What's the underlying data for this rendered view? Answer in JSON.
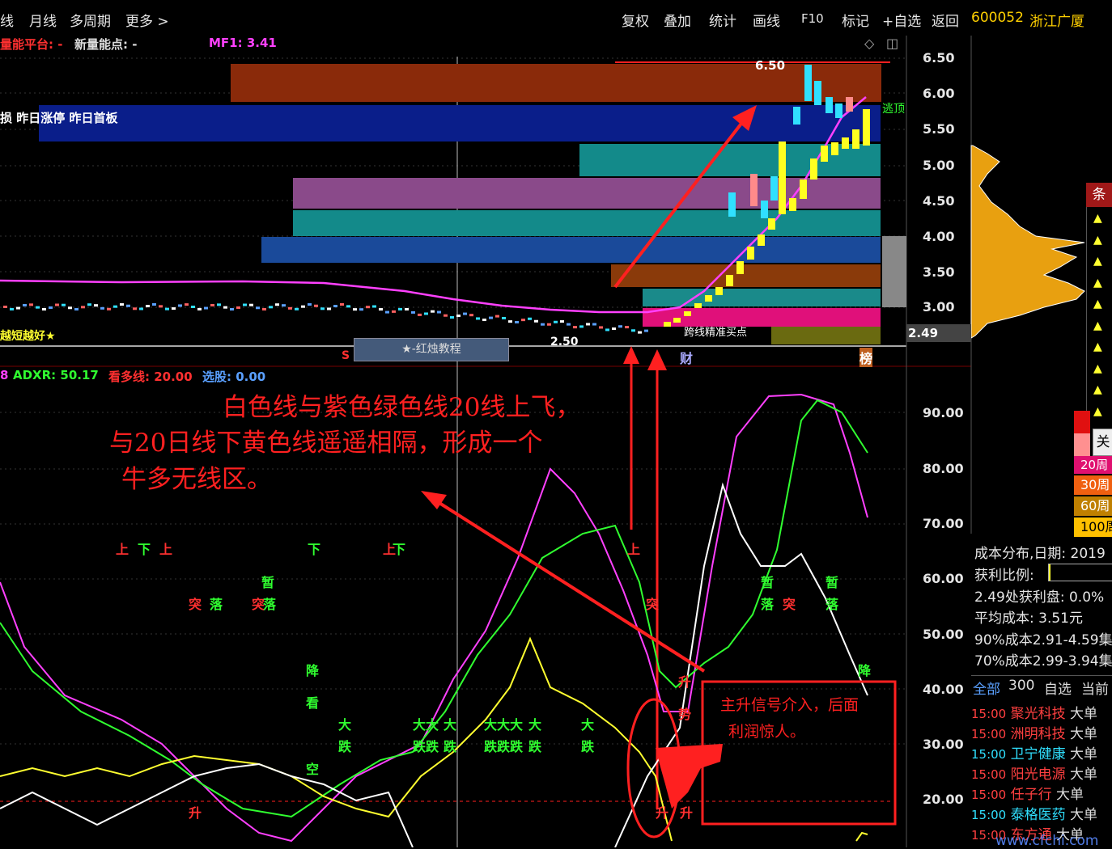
{
  "topbar": {
    "left_items": [
      "线",
      "月线",
      "多周期",
      "更多 >"
    ],
    "right_items": [
      "复权",
      "叠加",
      "统计",
      "画线",
      "F10",
      "标记",
      "+自选",
      "返回"
    ],
    "stock_code": "600052",
    "stock_name": "浙江广厦"
  },
  "indicator_top": {
    "left_label": "量能平台: -",
    "new_label": "新量能点: -",
    "mf1_label": "MF1: 3.41"
  },
  "price_chart": {
    "price_axis": [
      "6.50",
      "6.00",
      "5.50",
      "5.00",
      "4.50",
      "4.00",
      "3.50",
      "3.00"
    ],
    "current_price": "2.49",
    "high_label": "6.50",
    "low_label": "2.50",
    "band_label_left": "损 昨日涨停 昨日首板",
    "bottom_label": "越短越好★",
    "strategy_box": "★-红烛教程",
    "tag_s": "S",
    "tag_cai": "财",
    "tag_bang": "榜",
    "escape_label": "逃顶",
    "signal_label": "跨线精准买点"
  },
  "osc_chart": {
    "header_value": "8",
    "adxr_label": "ADXR: 50.17",
    "bull_label": "看多线: 20.00",
    "select_label": "选股: 0.00",
    "axis": [
      "90.00",
      "80.00",
      "70.00",
      "60.00",
      "50.00",
      "40.00",
      "30.00",
      "20.00"
    ]
  },
  "signals": [
    {
      "t": "上",
      "c": "#ff3030"
    },
    {
      "t": "下",
      "c": "#30ff30"
    },
    {
      "t": "上",
      "c": "#ff3030"
    },
    {
      "t": "下",
      "c": "#30ff30"
    },
    {
      "t": "上",
      "c": "#ff3030"
    },
    {
      "t": "下",
      "c": "#30ff30"
    },
    {
      "t": "上",
      "c": "#ff3030"
    },
    {
      "t": "暂",
      "c": "#30ff30"
    },
    {
      "t": "突",
      "c": "#ff3030"
    },
    {
      "t": "落",
      "c": "#30ff30"
    },
    {
      "t": "突",
      "c": "#ff3030"
    },
    {
      "t": "落",
      "c": "#30ff30"
    },
    {
      "t": "暂",
      "c": "#30ff30"
    },
    {
      "t": "暂",
      "c": "#30ff30"
    },
    {
      "t": "落",
      "c": "#30ff30"
    },
    {
      "t": "突",
      "c": "#ff3030"
    },
    {
      "t": "落",
      "c": "#30ff30"
    },
    {
      "t": "突",
      "c": "#ff3030"
    },
    {
      "t": "降",
      "c": "#30ff30"
    },
    {
      "t": "看",
      "c": "#30ff30"
    },
    {
      "t": "降",
      "c": "#30ff30"
    },
    {
      "t": "大",
      "c": "#30ff30"
    },
    {
      "t": "跌",
      "c": "#30ff30"
    },
    {
      "t": "大大",
      "c": "#30ff30"
    },
    {
      "t": "跌跌",
      "c": "#30ff30"
    },
    {
      "t": "大",
      "c": "#30ff30"
    },
    {
      "t": "跌",
      "c": "#30ff30"
    },
    {
      "t": "大大大",
      "c": "#30ff30"
    },
    {
      "t": "跌跌跌",
      "c": "#30ff30"
    },
    {
      "t": "大",
      "c": "#30ff30"
    },
    {
      "t": "跌",
      "c": "#30ff30"
    },
    {
      "t": "大",
      "c": "#30ff30"
    },
    {
      "t": "跌",
      "c": "#30ff30"
    },
    {
      "t": "升",
      "c": "#ff3030"
    },
    {
      "t": "势",
      "c": "#ff3030"
    },
    {
      "t": "升",
      "c": "#ff3030"
    },
    {
      "t": "升",
      "c": "#ff3030"
    },
    {
      "t": "升",
      "c": "#ff3030"
    },
    {
      "t": "空",
      "c": "#30ff30"
    }
  ],
  "annotations": {
    "main_text_1": "白色线与紫色绿色线20线上飞，",
    "main_text_2": "与20日线下黄色线遥遥相隔，形成一个",
    "main_text_3": "牛多无线区。",
    "box_text_1": "主升信号介入，后面",
    "box_text_2": "利润惊人。"
  },
  "side_panel": {
    "tab_label": "条件",
    "close_label": "关",
    "periods": [
      "20周",
      "30周",
      "60周",
      "100周"
    ],
    "cost_title": "成本分布,日期: 2019",
    "profit_ratio_label": "获利比例:",
    "profit_at": "2.49处获利盘: 0.0%",
    "avg_cost": "平均成本: 3.51元",
    "cost90": "90%成本2.91-4.59集",
    "cost70": "70%成本2.99-3.94集",
    "list_tabs": [
      "全部",
      "300",
      "自选",
      "当前"
    ]
  },
  "stock_list": [
    {
      "time": "15:00",
      "name": "聚光科技",
      "type": "大单",
      "color": "#ff4040"
    },
    {
      "time": "15:00",
      "name": "洲明科技",
      "type": "大单",
      "color": "#ff4040"
    },
    {
      "time": "15:00",
      "name": "卫宁健康",
      "type": "大单",
      "color": "#30e0ff"
    },
    {
      "time": "15:00",
      "name": "阳光电源",
      "type": "大单",
      "color": "#ff4040"
    },
    {
      "time": "15:00",
      "name": "任子行",
      "type": "大单",
      "color": "#ff4040"
    },
    {
      "time": "15:00",
      "name": "泰格医药",
      "type": "大单",
      "color": "#30e0ff"
    },
    {
      "time": "15:00",
      "name": "东方通",
      "type": "大单",
      "color": "#ff4040"
    }
  ],
  "watermark": "www.cfchi.com",
  "colors": {
    "red": "#ff2020",
    "magenta": "#ff40ff",
    "green": "#30ff30",
    "yellow": "#ffff00",
    "cyan": "#30e0ff",
    "white": "#ffffff"
  }
}
